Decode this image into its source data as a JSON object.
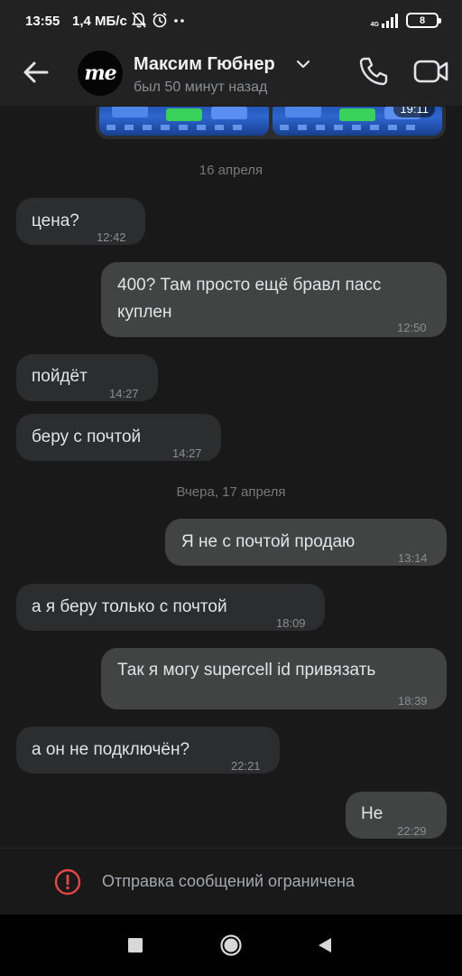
{
  "status_bar": {
    "time": "13:55",
    "speed": "1,4 МБ/с",
    "network": "4G",
    "battery": "8"
  },
  "header": {
    "avatar_text": "me",
    "title": "Максим Гюбнер",
    "subtitle": "был 50 минут назад"
  },
  "media_time": "19:11",
  "dates": {
    "d1": "16 апреля",
    "d2": "Вчера, 17 апреля"
  },
  "messages": [
    {
      "dir": "in",
      "text": "цена?",
      "time": "12:42"
    },
    {
      "dir": "out",
      "text": "400? Там просто ещё бравл пасс куплен",
      "time": "12:50"
    },
    {
      "dir": "in",
      "text": "пойдёт",
      "time": "14:27"
    },
    {
      "dir": "in",
      "text": "беру с почтой",
      "time": "14:27"
    },
    {
      "dir": "out",
      "text": "Я не с почтой продаю",
      "time": "13:14"
    },
    {
      "dir": "in",
      "text": "а я беру только с почтой",
      "time": "18:09"
    },
    {
      "dir": "out",
      "text": "Так я могу supercell id привязать",
      "time": "18:39"
    },
    {
      "dir": "in",
      "text": "а он не подключён?",
      "time": "22:21"
    },
    {
      "dir": "out",
      "text": "Не",
      "time": "22:29"
    }
  ],
  "restriction": {
    "text": "Отправка сообщений ограничена",
    "icon": "alert-circle-icon",
    "color": "#e64646"
  },
  "colors": {
    "background": "#191919",
    "bubble_in": "#2c2d2e",
    "bubble_out": "#424343"
  }
}
